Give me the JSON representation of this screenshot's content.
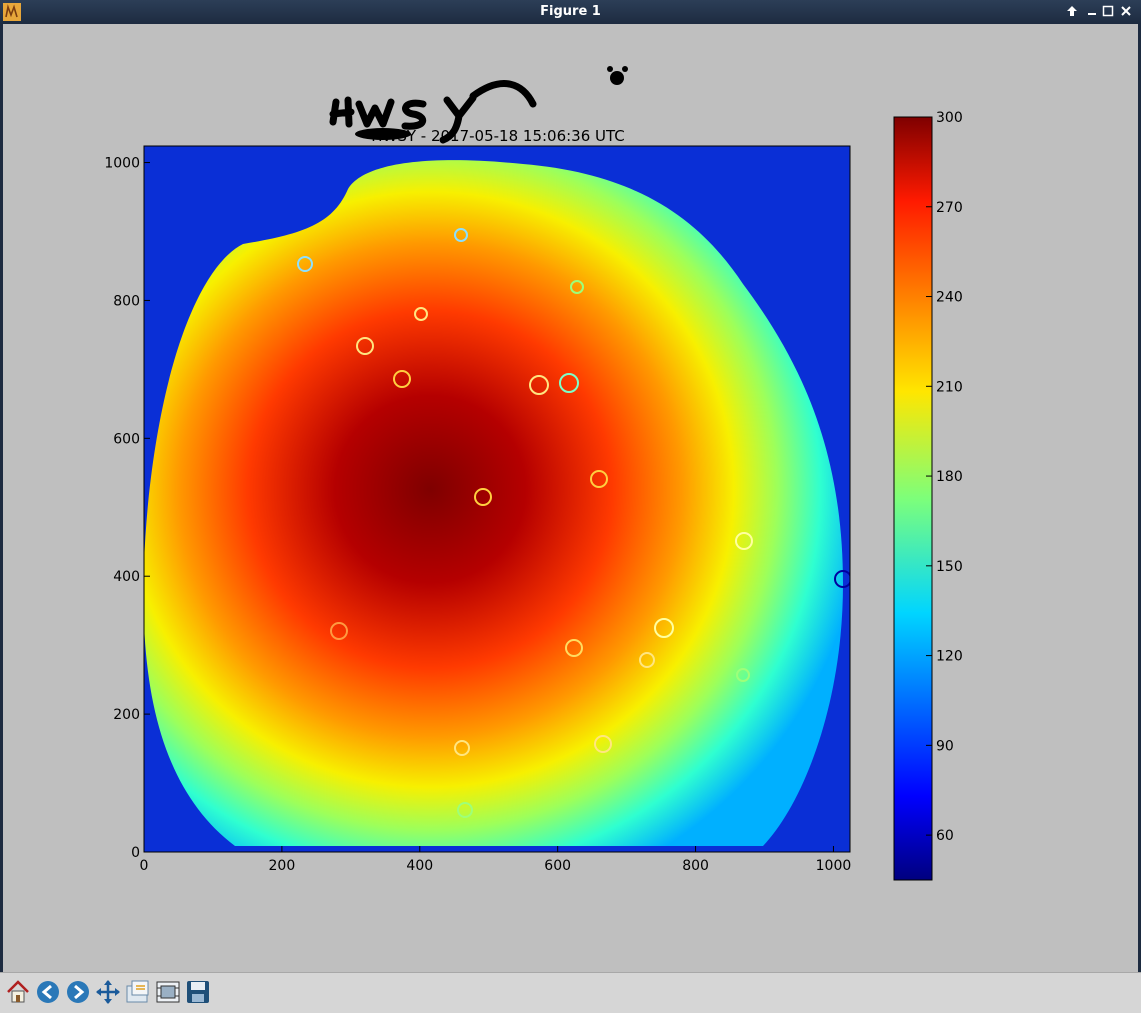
{
  "window": {
    "title": "Figure 1"
  },
  "figure": {
    "title": "HWSY - 2017-05-18 15:06:36 UTC",
    "annotation": "HWSY"
  },
  "chart_data": {
    "type": "heatmap",
    "title": "HWSY - 2017-05-18 15:06:36 UTC",
    "xlabel": "",
    "ylabel": "",
    "x_ticks": [
      "0",
      "200",
      "400",
      "600",
      "800",
      "1000"
    ],
    "y_ticks": [
      "0",
      "200",
      "400",
      "600",
      "800",
      "1000"
    ],
    "xlim": [
      0,
      1024
    ],
    "ylim": [
      0,
      1024
    ],
    "colormap": "jet",
    "colorbar": {
      "range": [
        45,
        300
      ],
      "ticks": [
        "60",
        "90",
        "120",
        "150",
        "180",
        "210",
        "240",
        "270",
        "300"
      ]
    },
    "description_values": {
      "center_approx": [
        430,
        500
      ],
      "peak_value": 300,
      "edge_value": 60
    }
  },
  "toolbar": {
    "buttons": [
      {
        "name": "home",
        "icon": "home-icon"
      },
      {
        "name": "back",
        "icon": "arrow-left-icon"
      },
      {
        "name": "forward",
        "icon": "arrow-right-icon"
      },
      {
        "name": "pan",
        "icon": "move-icon"
      },
      {
        "name": "zoom",
        "icon": "zoom-rect-icon"
      },
      {
        "name": "configure",
        "icon": "subplots-icon"
      },
      {
        "name": "save",
        "icon": "floppy-icon"
      }
    ]
  },
  "colors": {
    "titlebar": "#1d2b40",
    "figure_bg": "#bfbfbf"
  }
}
